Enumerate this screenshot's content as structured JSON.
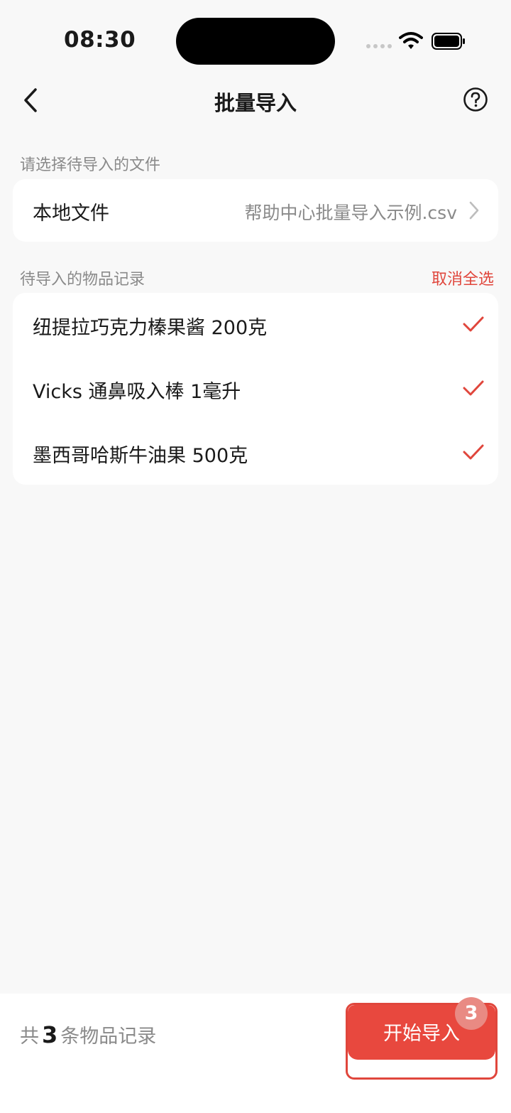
{
  "status_bar": {
    "time": "08:30"
  },
  "nav": {
    "title": "批量导入"
  },
  "file_section": {
    "label": "请选择待导入的文件",
    "row_label": "本地文件",
    "row_value": "帮助中心批量导入示例.csv"
  },
  "items_section": {
    "label": "待导入的物品记录",
    "deselect_all": "取消全选",
    "items": [
      {
        "name": "纽提拉巧克力榛果酱 200克",
        "checked": true
      },
      {
        "name": "Vicks 通鼻吸入棒 1毫升",
        "checked": true
      },
      {
        "name": "墨西哥哈斯牛油果 500克",
        "checked": true
      }
    ]
  },
  "bottom_bar": {
    "prefix": "共",
    "count": "3",
    "suffix": "条物品记录",
    "start_button": "开始导入",
    "badge": "3"
  },
  "colors": {
    "accent": "#e0463c",
    "background": "#f8f8f8",
    "muted_text": "#8a8a8a"
  }
}
